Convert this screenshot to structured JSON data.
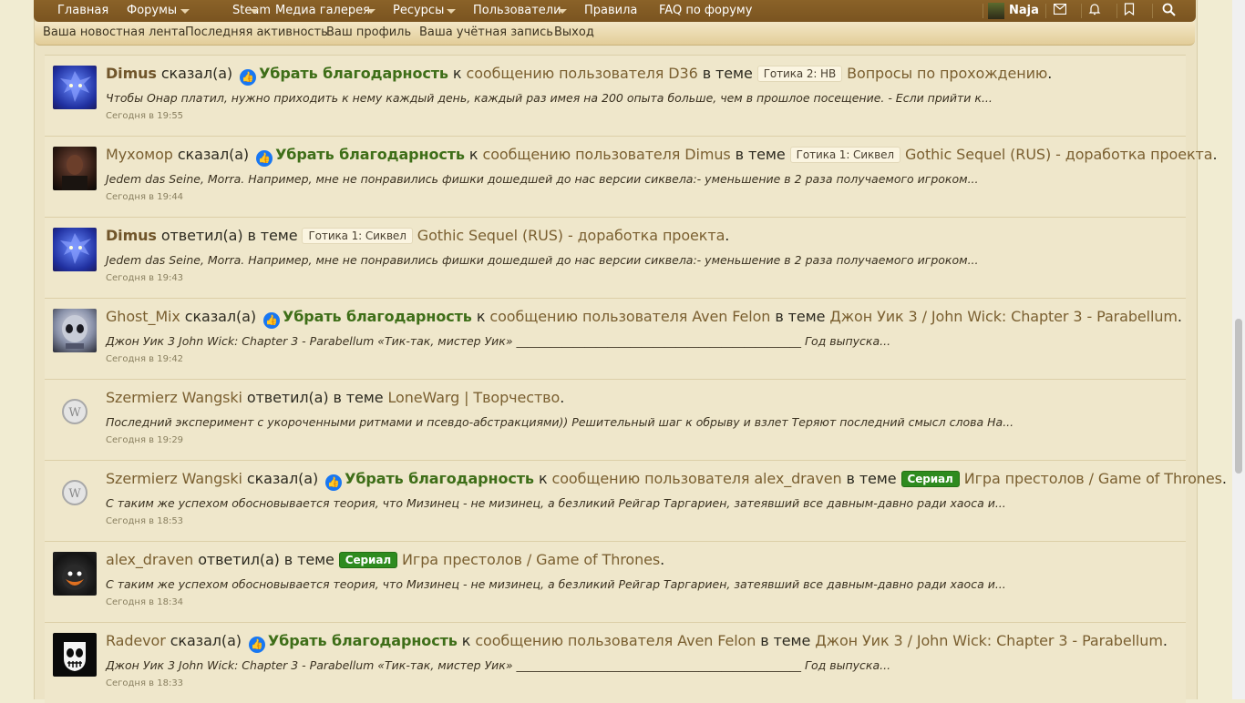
{
  "nav": {
    "items": [
      "Главная",
      "Форумы",
      "Steam",
      "Медиа галерея",
      "Ресурсы",
      "Пользователи",
      "Правила",
      "FAQ по форуму"
    ],
    "username": "Naja",
    "icons": [
      "envelope-icon",
      "bell-icon",
      "bookmark-icon",
      "search-icon"
    ]
  },
  "subnav": {
    "items": [
      "Ваша новостная лента",
      "Последняя активность",
      "Ваш профиль",
      "Ваша учётная запись",
      "Выход"
    ]
  },
  "feed": {
    "items": [
      {
        "user": "Dimus",
        "verb": "сказал(а)",
        "unlike": "Убрать благодарность",
        "mid": "к",
        "mid_link": "сообщению пользователя D36",
        "theme": "в теме",
        "tag": "Готика 2: НВ",
        "topic": "Вопросы по прохождению",
        "snippet": "Чтобы Онар платил, нужно приходить к нему каждый день, каждый раз имея на 200 опыта больше, чем в прошлое посещение. - Если прийти к...",
        "time": "Сегодня в 19:55"
      },
      {
        "user": "Мухомор",
        "verb": "сказал(а)",
        "unlike": "Убрать благодарность",
        "mid": "к",
        "mid_link": "сообщению пользователя Dimus",
        "theme": "в теме",
        "tag": "Готика 1: Сиквел",
        "topic": "Gothic Sequel (RUS) - доработка проекта",
        "snippet": "Jedem das Seine, Morra. Например, мне не понравились фишки дошедшей до нас версии сиквела:- уменьшение в 2 раза получаемого игроком...",
        "time": "Сегодня в 19:44"
      },
      {
        "user": "Dimus",
        "verb": "ответил(а) в теме",
        "tag": "Готика 1: Сиквел",
        "topic": "Gothic Sequel (RUS) - доработка проекта",
        "snippet": "Jedem das Seine, Morra. Например, мне не понравились фишки дошедшей до нас версии сиквела:- уменьшение в 2 раза получаемого игроком...",
        "time": "Сегодня в 19:43"
      },
      {
        "user": "Ghost_Mix",
        "verb": "сказал(а)",
        "unlike": "Убрать благодарность",
        "mid": "к",
        "mid_link": "сообщению пользователя Aven Felon",
        "theme": "в теме",
        "topic": "Джон Уик 3 / John Wick: Chapter 3 - Parabellum",
        "snippet": "Джон Уик 3 John Wick: Chapter 3 - Parabellum «Тик-так, мистер Уик» __________________________________________________ Год выпуска...",
        "time": "Сегодня в 19:42"
      },
      {
        "user": "Szermierz Wangski",
        "verb": "ответил(а) в теме",
        "topic": "LoneWarg | Творчество",
        "snippet": "Последний эксперимент с укороченными ритмами и псевдо-абстракциями)) Решительный шаг к обрыву и взлет Теряют последний смысл слова На...",
        "time": "Сегодня в 19:29"
      },
      {
        "user": "Szermierz Wangski",
        "verb": "сказал(а)",
        "unlike": "Убрать благодарность",
        "mid": "к",
        "mid_link": "сообщению пользователя alex_draven",
        "theme": "в теме",
        "tag": "Сериал",
        "topic": "Игра престолов / Game of Thrones",
        "snippet": "С таким же успехом обосновывается теория, что Мизинец - не мизинец, а безликий Рейгар Таргариен, затеявший все давным-давно ради хаоса и...",
        "time": "Сегодня в 18:53"
      },
      {
        "user": "alex_draven",
        "verb": "ответил(а) в теме",
        "tag": "Сериал",
        "topic": "Игра престолов / Game of Thrones",
        "snippet": "С таким же успехом обосновывается теория, что Мизинец - не мизинец, а безликий Рейгар Таргариен, затеявший все давным-давно ради хаоса и...",
        "time": "Сегодня в 18:34"
      },
      {
        "user": "Radevor",
        "verb": "сказал(а)",
        "unlike": "Убрать благодарность",
        "mid": "к",
        "mid_link": "сообщению пользователя Aven Felon",
        "theme": "в теме",
        "topic": "Джон Уик 3 / John Wick: Chapter 3 - Parabellum",
        "snippet": "Джон Уик 3 John Wick: Chapter 3 - Parabellum «Тик-так, мистер Уик» __________________________________________________ Год выпуска...",
        "time": "Сегодня в 18:33"
      }
    ]
  },
  "colors": {
    "nav_bg": "#7a5420",
    "page_bg": "#ece3c5",
    "link": "#7a5f30",
    "unlike": "#3e6e18",
    "tag_green": "#2e8b1f",
    "like_icon": "#1877f2"
  }
}
